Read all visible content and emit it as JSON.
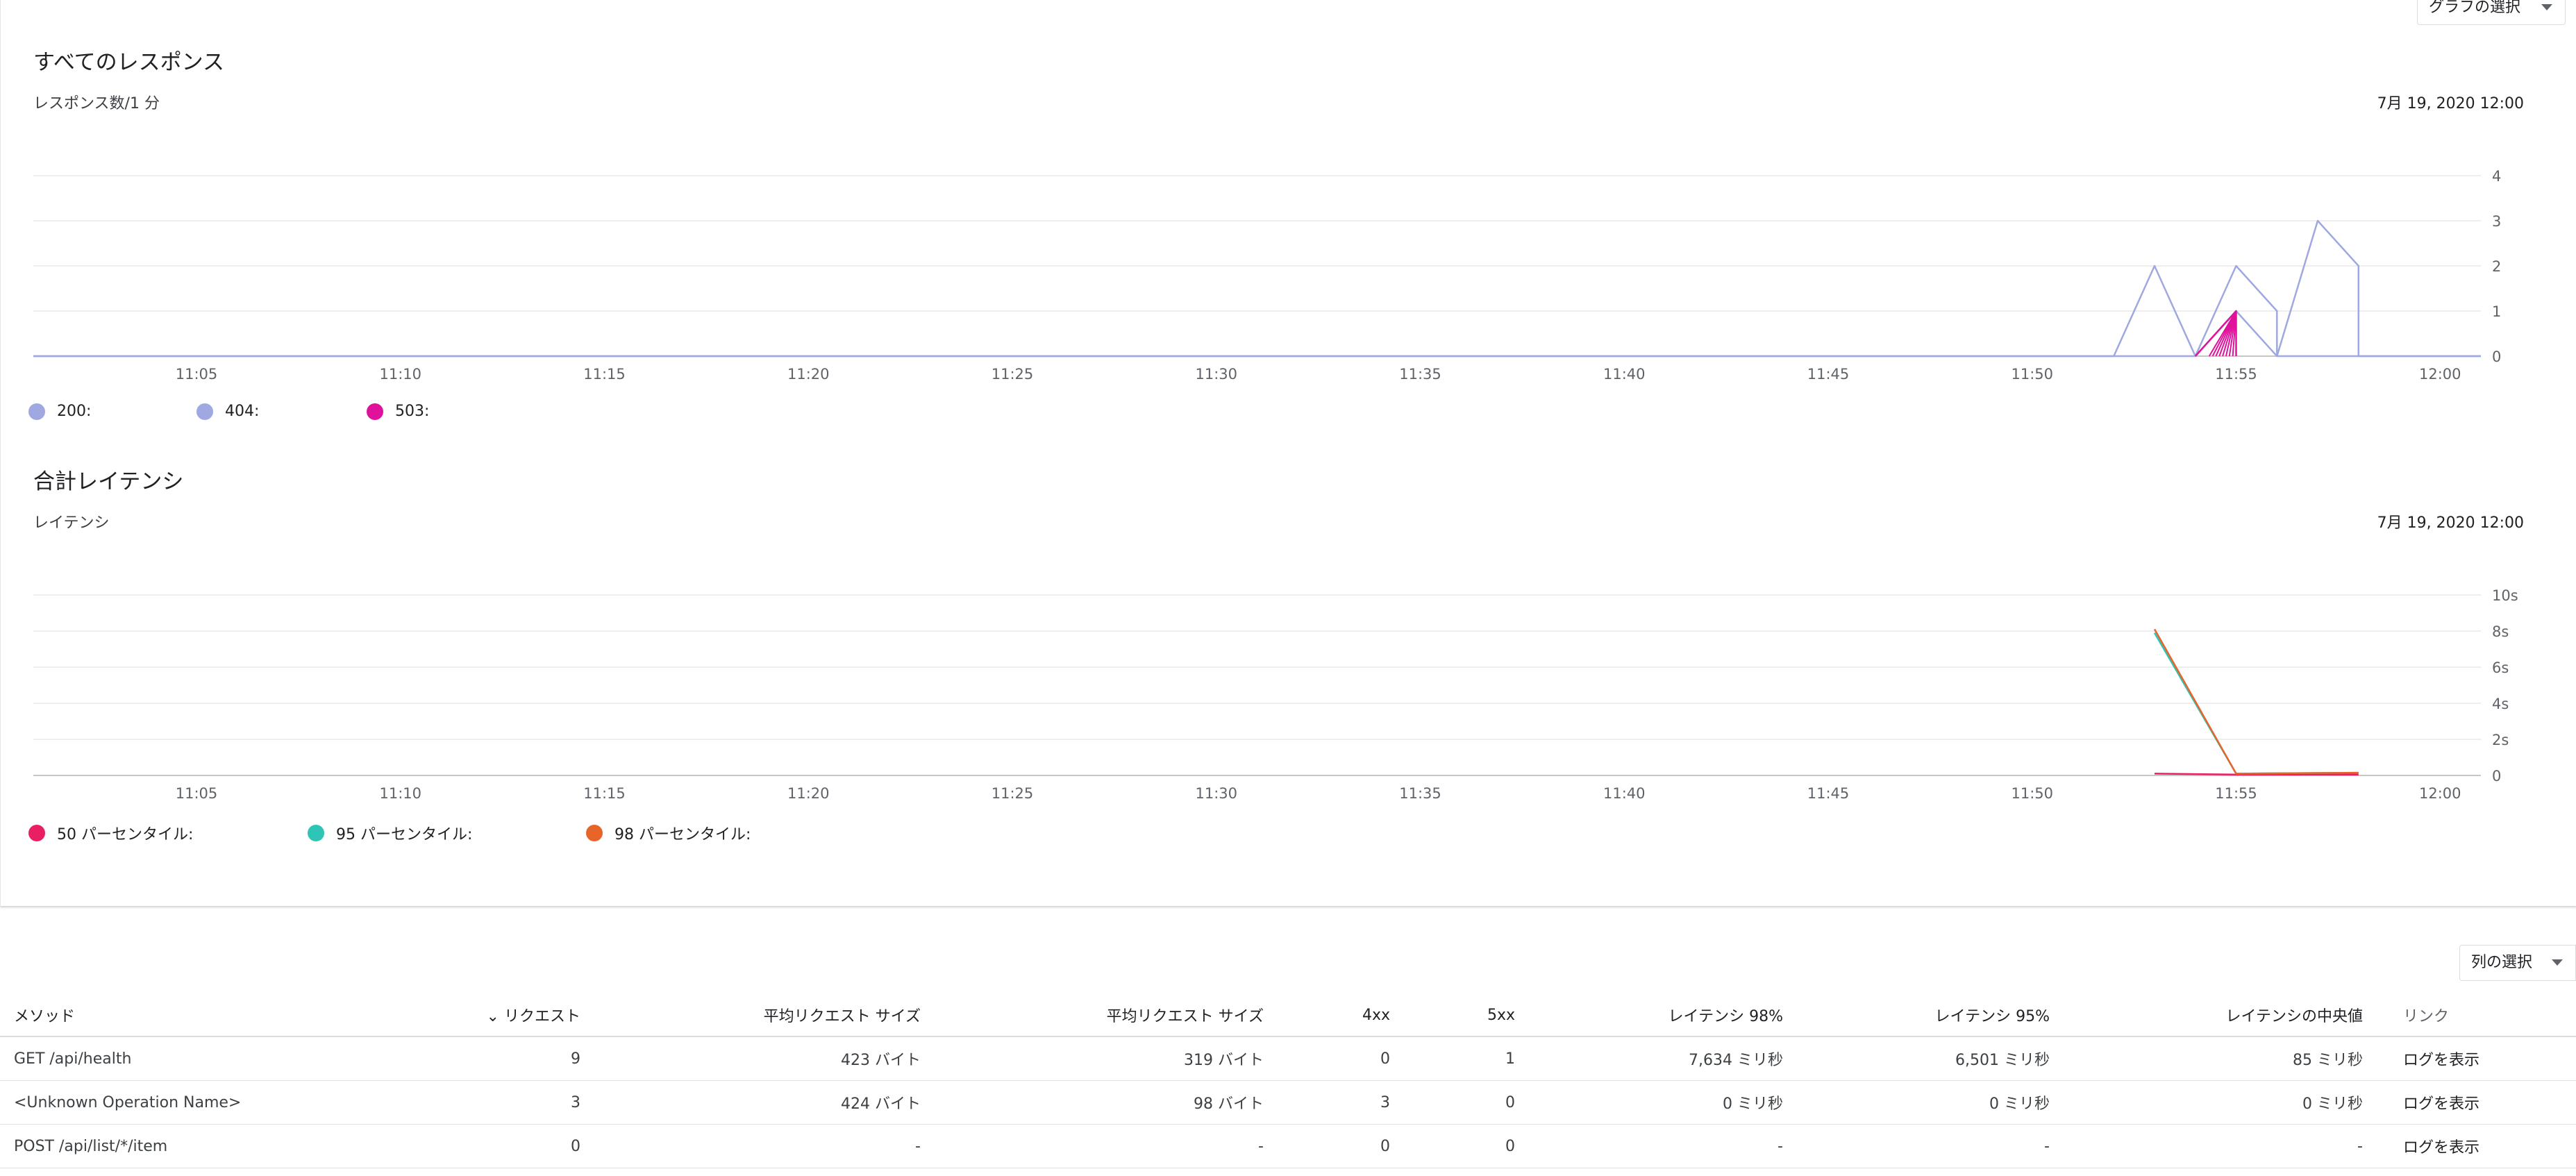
{
  "graph_select_label": "グラフの選択",
  "chart_responses": {
    "title": "すべてのレスポンス",
    "subtitle": "レスポンス数/1 分",
    "date": "7月 19, 2020 12:00",
    "legend": [
      {
        "label": "200:",
        "color": "#9fa8e0"
      },
      {
        "label": "404:",
        "color": "#9fa8e0"
      },
      {
        "label": "503:",
        "color": "#e0119b"
      }
    ]
  },
  "chart_latency": {
    "title": "合計レイテンシ",
    "subtitle": "レイテンシ",
    "date": "7月 19, 2020 12:00",
    "legend": [
      {
        "label": "50 パーセンタイル:",
        "color": "#e91e63"
      },
      {
        "label": "95 パーセンタイル:",
        "color": "#2ec4b6"
      },
      {
        "label": "98 パーセンタイル:",
        "color": "#e8652a"
      }
    ]
  },
  "chart_data": [
    {
      "type": "line",
      "title": "すべてのレスポンス",
      "subtitle": "レスポンス数/1 分",
      "x_ticks": [
        "11:05",
        "11:10",
        "11:15",
        "11:20",
        "11:25",
        "11:30",
        "11:35",
        "11:40",
        "11:45",
        "11:50",
        "11:55",
        "12:00"
      ],
      "y_ticks": [
        "0",
        "1",
        "2",
        "3",
        "4"
      ],
      "xlim": [
        "11:01",
        "12:01"
      ],
      "ylim": [
        0,
        4
      ],
      "grid": true,
      "legend_position": "bottom-left",
      "series": [
        {
          "name": "200:",
          "color": "#9fa8e0",
          "points": [
            [
              "11:01",
              0
            ],
            [
              "11:52",
              0
            ],
            [
              "11:53",
              2
            ],
            [
              "11:54",
              0
            ],
            [
              "11:55",
              2
            ],
            [
              "11:56",
              1
            ],
            [
              "11:56",
              0
            ],
            [
              "11:57",
              3
            ],
            [
              "11:58",
              2
            ],
            [
              "11:58",
              0
            ],
            [
              "12:01",
              0
            ]
          ]
        },
        {
          "name": "404:",
          "color": "#9fa8e0",
          "points": [
            [
              "11:01",
              0
            ],
            [
              "11:54",
              0
            ],
            [
              "11:55",
              1
            ],
            [
              "11:56",
              0
            ],
            [
              "12:01",
              0
            ]
          ]
        },
        {
          "name": "503:",
          "color": "#e0119b",
          "points": [
            [
              "11:54",
              0
            ],
            [
              "11:55",
              1
            ],
            [
              "11:55",
              0
            ]
          ]
        }
      ]
    },
    {
      "type": "line",
      "title": "合計レイテンシ",
      "subtitle": "レイテンシ",
      "x_ticks": [
        "11:05",
        "11:10",
        "11:15",
        "11:20",
        "11:25",
        "11:30",
        "11:35",
        "11:40",
        "11:45",
        "11:50",
        "11:55",
        "12:00"
      ],
      "y_ticks": [
        "0",
        "2s",
        "4s",
        "6s",
        "8s",
        "10s"
      ],
      "xlim": [
        "11:01",
        "12:01"
      ],
      "ylim": [
        0,
        10
      ],
      "grid": true,
      "legend_position": "bottom-left",
      "series": [
        {
          "name": "50 パーセンタイル",
          "color": "#e91e63",
          "points": [
            [
              "11:53",
              0.1
            ],
            [
              "11:55",
              0.05
            ],
            [
              "11:58",
              0.05
            ]
          ]
        },
        {
          "name": "95 パーセンタイル",
          "color": "#2ec4b6",
          "points": [
            [
              "11:53",
              7.9
            ],
            [
              "11:55",
              0.1
            ],
            [
              "11:58",
              0.15
            ]
          ]
        },
        {
          "name": "98 パーセンタイル",
          "color": "#e8652a",
          "points": [
            [
              "11:53",
              8.1
            ],
            [
              "11:55",
              0.1
            ],
            [
              "11:58",
              0.15
            ]
          ]
        }
      ]
    }
  ],
  "column_select_label": "列の選択",
  "table": {
    "headers": {
      "method": "メソッド",
      "requests": "リクエスト",
      "avg_req_size": "平均リクエスト サイズ",
      "avg_res_size": "平均リクエスト サイズ",
      "c4xx": "4xx",
      "c5xx": "5xx",
      "lat98": "レイテンシ 98%",
      "lat95": "レイテンシ 95%",
      "latmed": "レイテンシの中央値",
      "link": "リンク"
    },
    "rows": [
      {
        "method": "GET /api/health",
        "requests": "9",
        "avg_req_size": "423 バイト",
        "avg_res_size": "319 バイト",
        "c4xx": "0",
        "c5xx": "1",
        "lat98": "7,634 ミリ秒",
        "lat95": "6,501 ミリ秒",
        "latmed": "85 ミリ秒",
        "link": "ログを表示"
      },
      {
        "method": "<Unknown Operation Name>",
        "requests": "3",
        "avg_req_size": "424 バイト",
        "avg_res_size": "98 バイト",
        "c4xx": "3",
        "c5xx": "0",
        "lat98": "0 ミリ秒",
        "lat95": "0 ミリ秒",
        "latmed": "0 ミリ秒",
        "link": "ログを表示"
      },
      {
        "method": "POST /api/list/*/item",
        "requests": "0",
        "avg_req_size": "-",
        "avg_res_size": "-",
        "c4xx": "0",
        "c5xx": "0",
        "lat98": "-",
        "lat95": "-",
        "latmed": "-",
        "link": "ログを表示"
      }
    ]
  }
}
